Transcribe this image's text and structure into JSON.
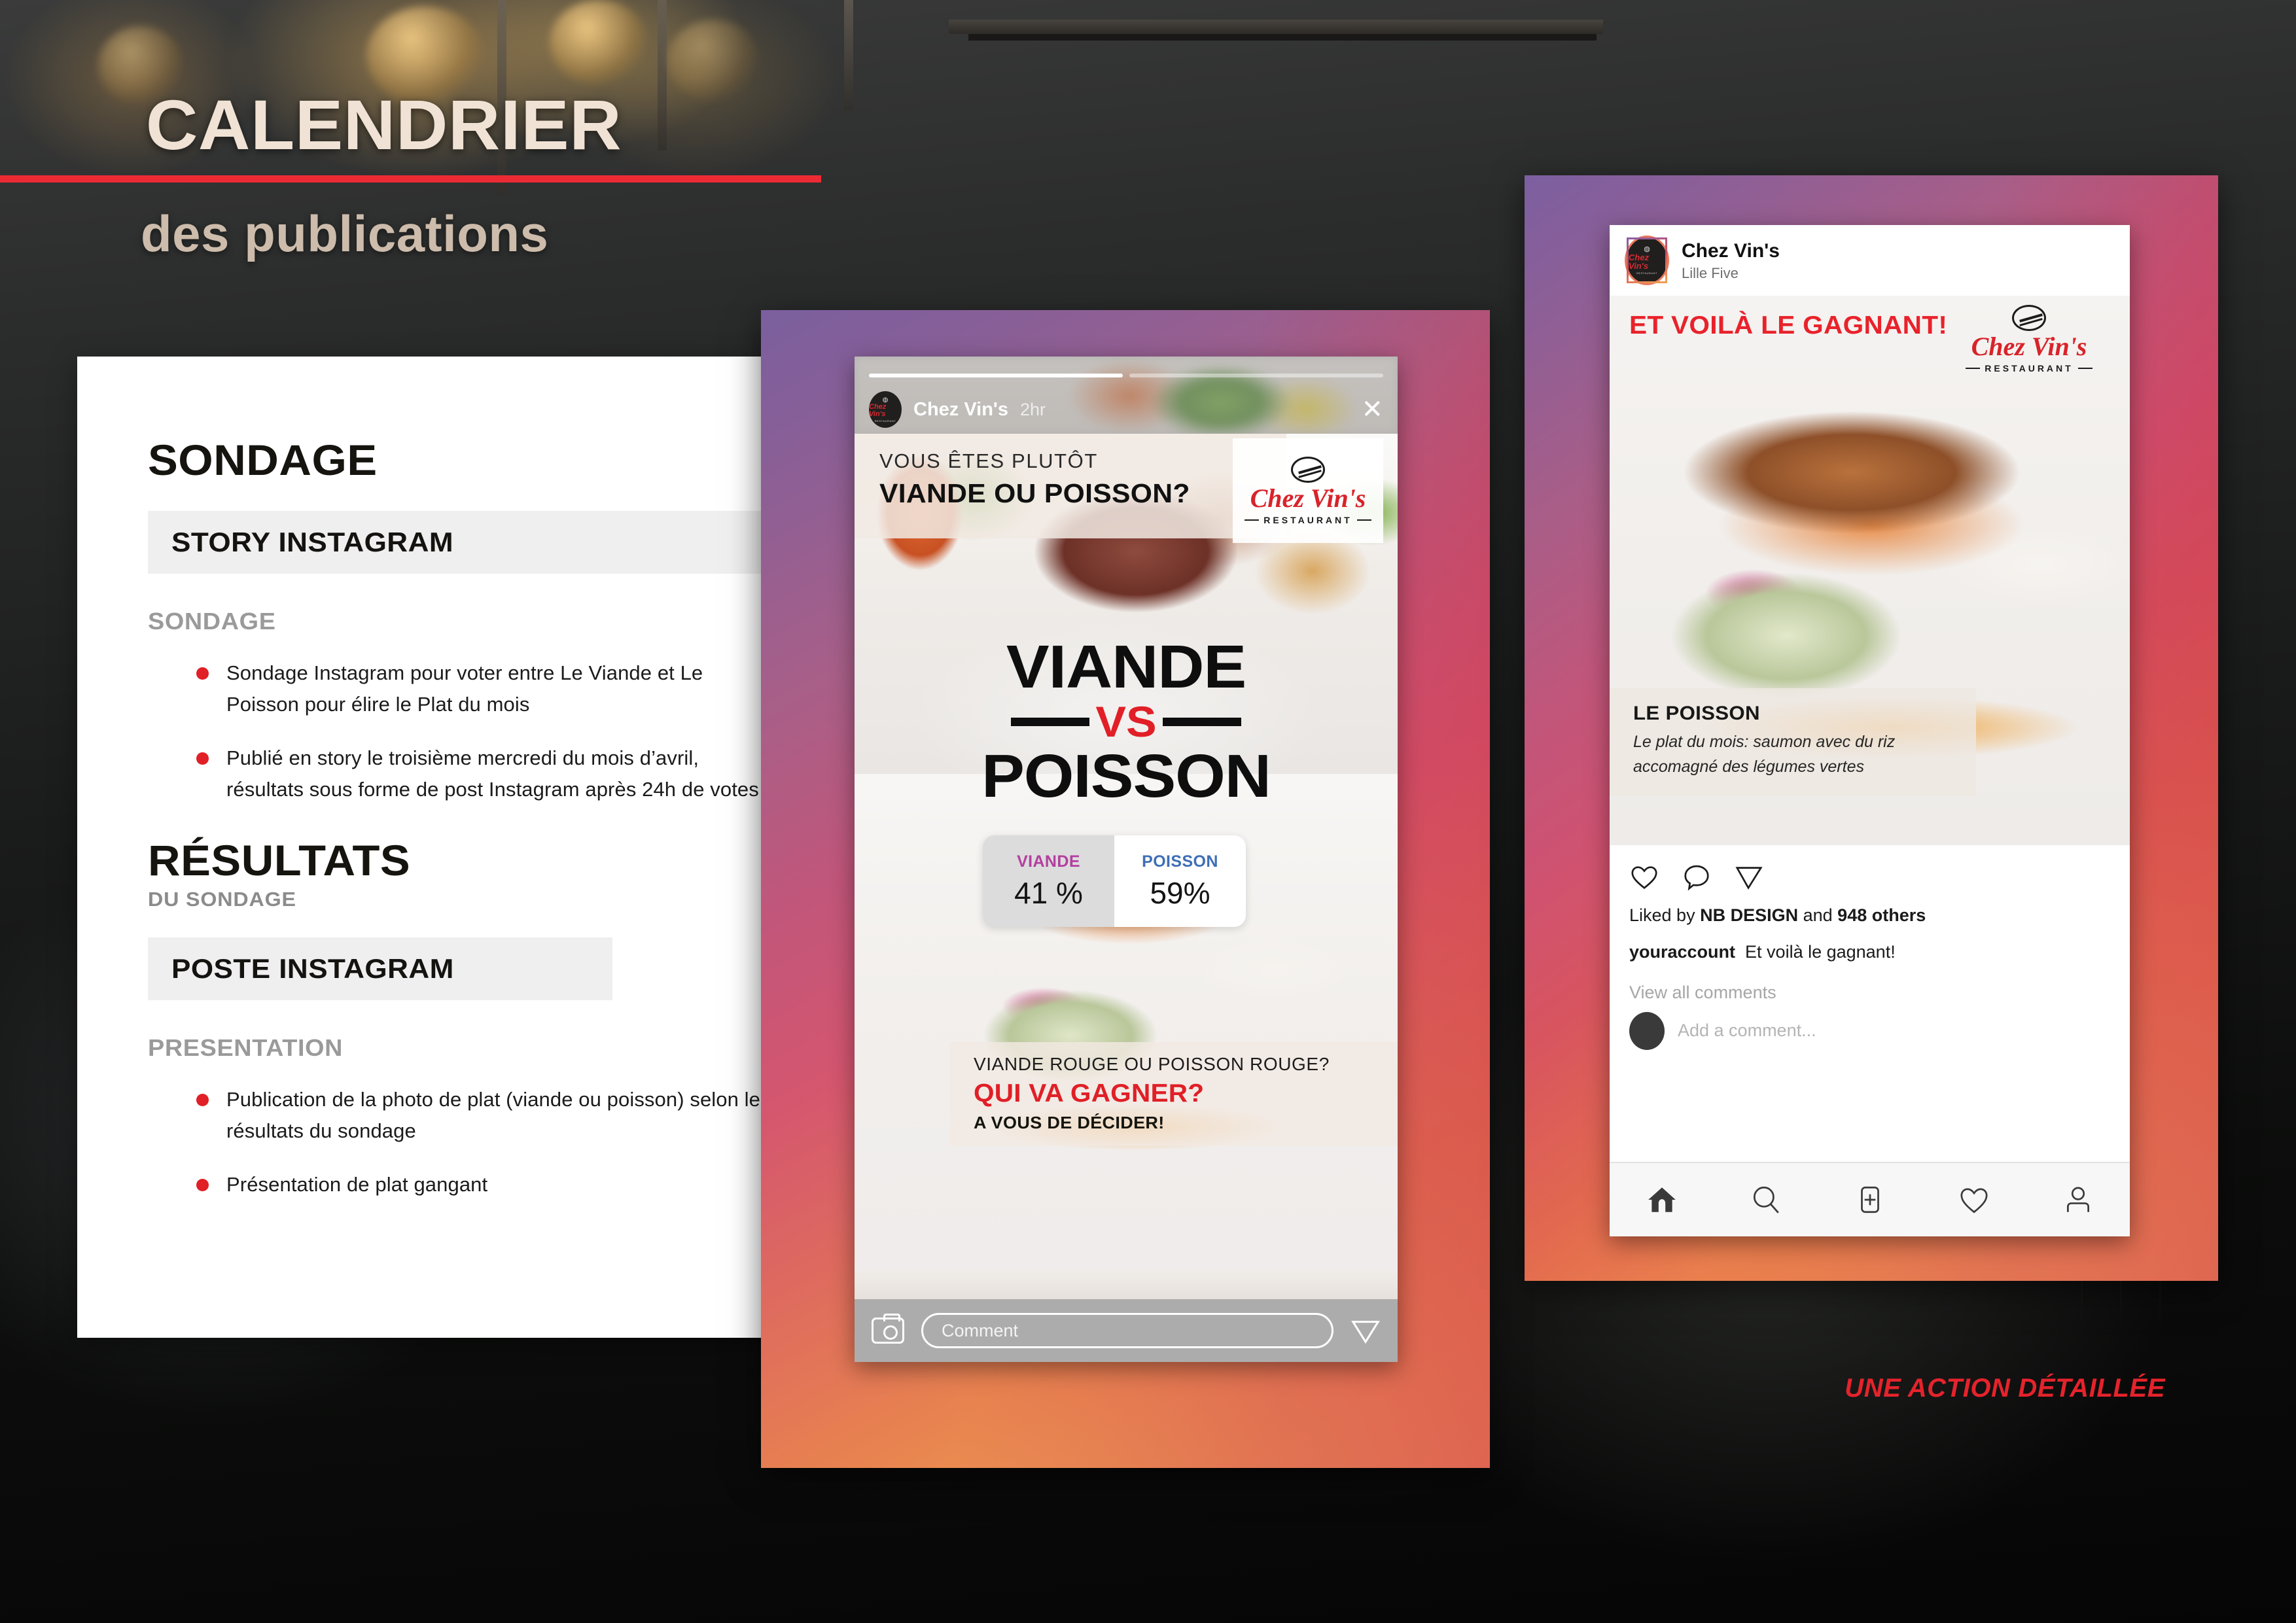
{
  "header": {
    "title": "CALENDRIER",
    "subtitle": "des publications"
  },
  "left_panel": {
    "section1": {
      "heading": "SONDAGE",
      "bar_label": "STORY INSTAGRAM",
      "sub_label": "SONDAGE",
      "bullets": [
        "Sondage Instagram pour voter entre Le Viande et Le Poisson pour élire le Plat du mois",
        "Publié en story le troisième mercredi du mois d’avril, résultats sous forme de post Instagram après 24h de votes"
      ]
    },
    "section2": {
      "heading": "RÉSULTATS",
      "heading_sub": "DU SONDAGE",
      "bar_label": "POSTE INSTAGRAM",
      "sub_label": "PRESENTATION",
      "bullets": [
        "Publication de la photo de plat (viande ou poisson) selon les résultats du sondage",
        "Présentation de plat gangant"
      ]
    }
  },
  "story": {
    "account_name": "Chez Vin's",
    "timestamp": "2hr",
    "close_label": "✕",
    "question_line1": "VOUS ÊTES PLUTÔT",
    "question_line2": "VIANDE OU POISSON?",
    "brand": {
      "name": "Chez Vin's",
      "tagline": "RESTAURANT"
    },
    "vs_top": "VIANDE",
    "vs_mid": "VS",
    "vs_bottom": "POISSON",
    "poll": {
      "option_a_label": "VIANDE",
      "option_a_value": "41 %",
      "option_b_label": "POISSON",
      "option_b_value": "59%"
    },
    "caption_line1": "VIANDE ROUGE OU POISSON ROUGE?",
    "caption_line2": "QUI VA GAGNER?",
    "caption_line3": "A VOUS DE DÉCIDER!",
    "comment_placeholder": "Comment"
  },
  "post": {
    "account_name": "Chez Vin's",
    "location": "Lille Five",
    "winner_banner": "ET VOILÀ LE GAGNANT!",
    "brand": {
      "name": "Chez Vin's",
      "tagline": "RESTAURANT"
    },
    "dish_title": "LE POISSON",
    "dish_desc": "Le plat du mois: saumon avec du riz accomagné des légumes  vertes",
    "liked_prefix": "Liked by ",
    "liked_user": "NB DESIGN",
    "liked_and": " and ",
    "liked_count": "948 others",
    "caption_user": "youraccount",
    "caption_text": "Et voilà le gagnant!",
    "view_comments": "View all comments",
    "add_comment_placeholder": "Add a comment..."
  },
  "footer": {
    "slogan": "UNE ACTION DÉTAILLÉE"
  },
  "colors": {
    "accent_red": "#e5232c",
    "brand_red": "#d8232a",
    "title_cream": "#f0e2d4",
    "subtitle_tan": "#cdbcab",
    "gradient_purple": "#7a5f9e",
    "gradient_crimson": "#ce5272",
    "gradient_orange": "#f2ad5c",
    "poll_viande": "#b33fa0",
    "poll_poisson": "#3f6fb5"
  }
}
